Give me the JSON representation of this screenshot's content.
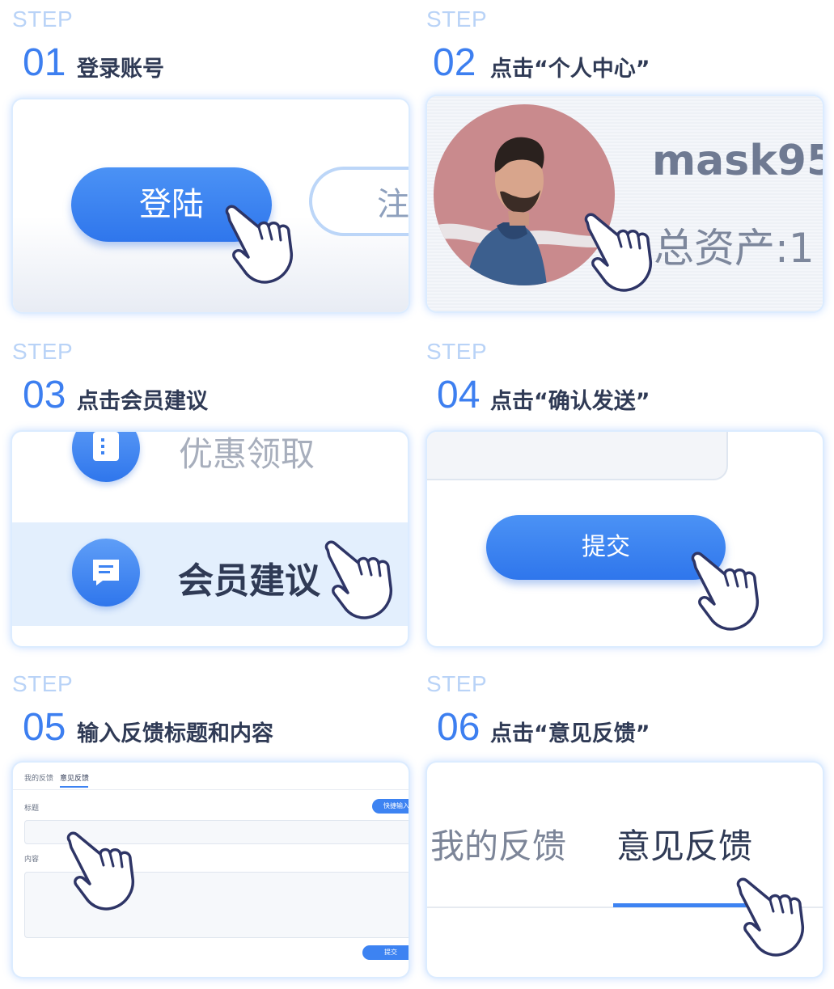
{
  "step_word": "STEP",
  "steps": [
    {
      "num": "01",
      "title": "登录账号",
      "login_button": "登陆",
      "register_button": "注"
    },
    {
      "num": "02",
      "title": "点击“个人中心”",
      "username": "mask95",
      "assets_label": "总资产:1"
    },
    {
      "num": "03",
      "title": "点击会员建议",
      "menu_coupon": "优惠领取",
      "menu_suggestion": "会员建议"
    },
    {
      "num": "04",
      "title": "点击“确认发送”",
      "submit_button": "提交"
    },
    {
      "num": "05",
      "title": "输入反馈标题和内容",
      "tab_my_feedback": "我的反馈",
      "tab_feedback": "意见反馈",
      "title_label": "标题",
      "quick_input_button": "快捷输入",
      "content_label": "内容",
      "submit_button": "提交"
    },
    {
      "num": "06",
      "title": "点击“意见反馈”",
      "tab_my_feedback": "我的反馈",
      "tab_feedback": "意见反馈"
    }
  ],
  "colors": {
    "accent": "#3d7ff0",
    "step_label": "#b9d3f7",
    "title": "#2f3a55",
    "highlight_row": "#e3effd"
  },
  "icons": [
    "hand-pointer-icon",
    "coupon-icon",
    "message-icon",
    "avatar-photo"
  ]
}
